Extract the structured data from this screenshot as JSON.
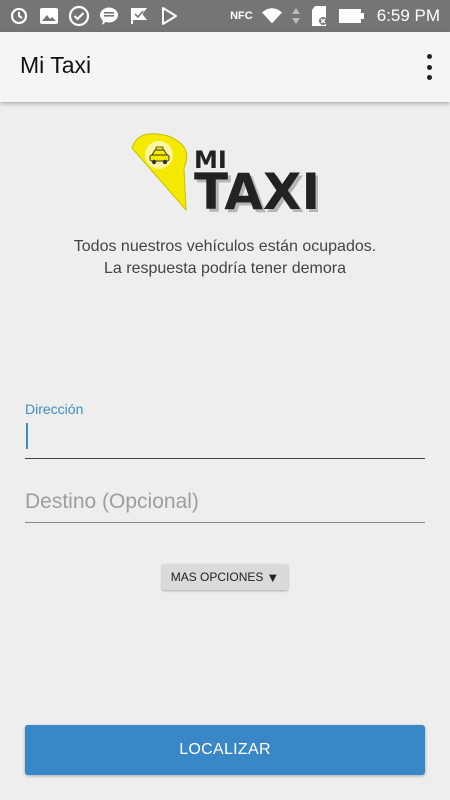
{
  "status_bar": {
    "time": "6:59 PM",
    "nfc_label": "NFC",
    "icons": [
      "sync-icon",
      "photo-icon",
      "check-circle-icon",
      "message-icon",
      "flag-icon",
      "play-store-icon",
      "nfc-icon",
      "wifi-icon",
      "data-arrows-icon",
      "sd-card-icon",
      "battery-icon"
    ]
  },
  "app_bar": {
    "title": "Mi Taxi",
    "menu_icon": "more-vert-icon"
  },
  "logo": {
    "text_top": "MI",
    "text_bottom": "TAXI",
    "pin_color": "#f5e900"
  },
  "message": {
    "line1": "Todos nuestros vehículos están ocupados.",
    "line2": "La respuesta podría tener demora"
  },
  "form": {
    "address_label": "Dirección",
    "address_value": "",
    "destination_placeholder": "Destino (Opcional)",
    "more_options_label": "MAS OPCIONES",
    "more_options_icon": "triangle-down-icon",
    "locate_label": "LOCALIZAR"
  },
  "colors": {
    "accent": "#3a8fc0",
    "primary_button": "#3a87c8",
    "status_bar": "#757575",
    "background": "#eeeeee"
  }
}
